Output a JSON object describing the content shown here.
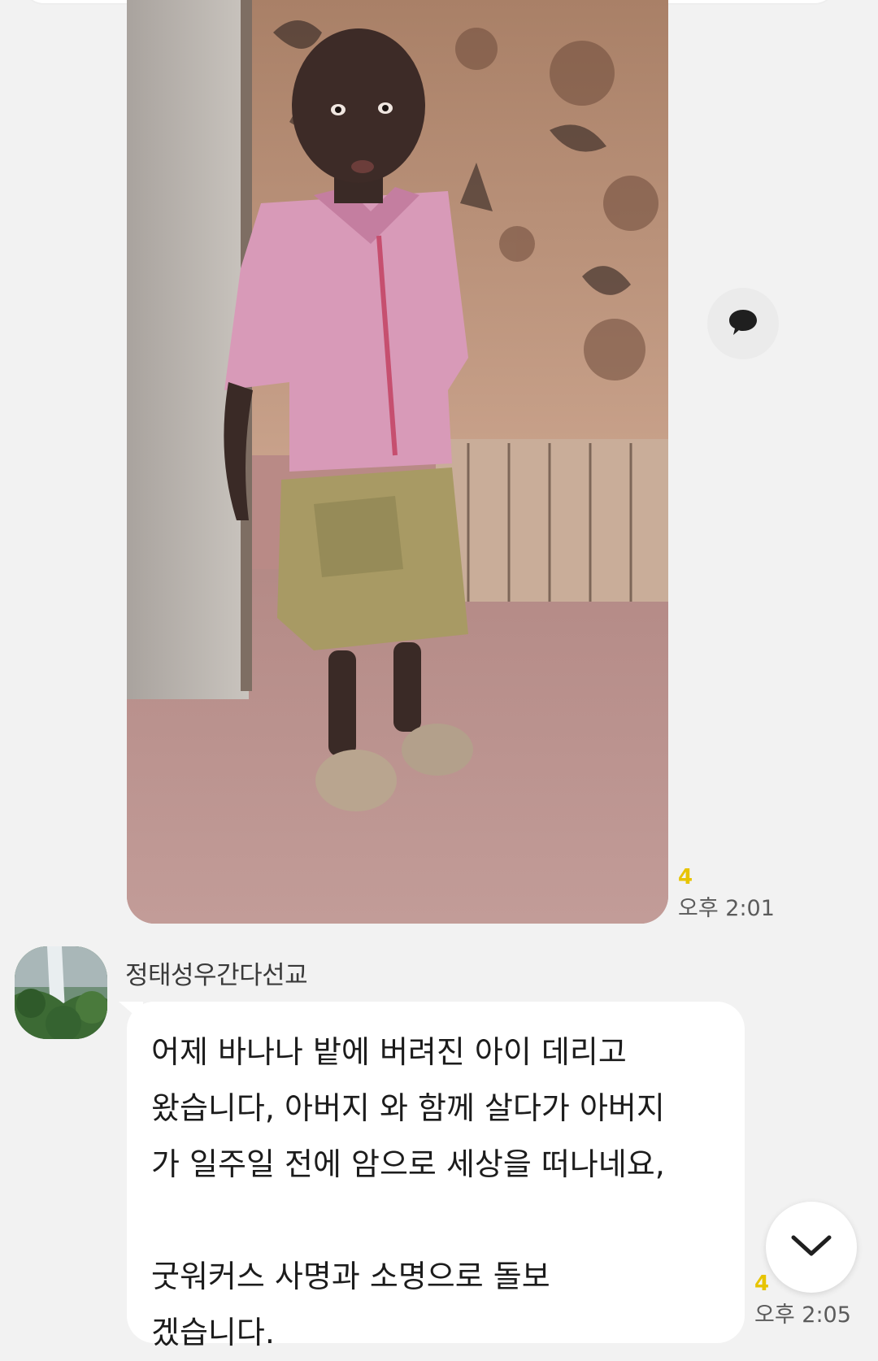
{
  "messages": [
    {
      "kind": "photo",
      "unread_count": "4",
      "time": "오후 2:01"
    },
    {
      "kind": "text",
      "sender": "정태성우간다선교",
      "lines": [
        "어제 바나나 밭에 버려진 아이 데리고",
        "왔습니다, 아버지 와 함께 살다가 아버지",
        "가 일주일 전에 암으로 세상을 떠나네요,",
        "",
        "굿워커스 사명과 소명으로 돌보",
        "겠습니다."
      ],
      "unread_count": "4",
      "time": "오후 2:05"
    }
  ],
  "icons": {
    "comment": "speech-bubble-icon",
    "scroll_down": "chevron-down-icon"
  },
  "colors": {
    "background": "#f2f2f2",
    "bubble": "#ffffff",
    "unread": "#e7c400",
    "time_text": "#5b5b5b"
  }
}
